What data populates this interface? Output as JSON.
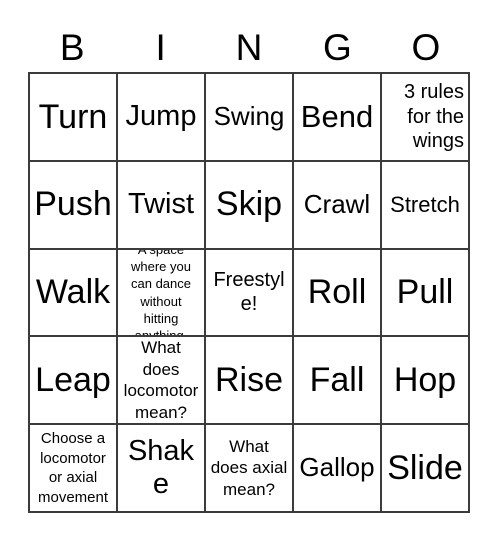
{
  "card": {
    "title_letters": [
      "B",
      "I",
      "N",
      "G",
      "O"
    ],
    "columns": 5,
    "rows": 5,
    "border_color": "#3b3b3b",
    "background_color": "#ffffff",
    "text_color": "#000000"
  },
  "cells": [
    {
      "text": "Turn",
      "size": "fs-xxl",
      "align": "align-center"
    },
    {
      "text": "Jump",
      "size": "fs-l",
      "align": "align-center"
    },
    {
      "text": "Swing",
      "size": "fs-m",
      "align": "align-center"
    },
    {
      "text": "Bend",
      "size": "fs-xl",
      "align": "align-center"
    },
    {
      "text": "3 rules for the wings",
      "size": "fs-xs",
      "align": "align-right"
    },
    {
      "text": "Push",
      "size": "fs-xxl",
      "align": "align-center"
    },
    {
      "text": "Twist",
      "size": "fs-l",
      "align": "align-center"
    },
    {
      "text": "Skip",
      "size": "fs-xxl",
      "align": "align-center"
    },
    {
      "text": "Crawl",
      "size": "fs-m",
      "align": "align-center"
    },
    {
      "text": "Stretch",
      "size": "fs-s",
      "align": "align-center"
    },
    {
      "text": "Walk",
      "size": "fs-xxl",
      "align": "align-center"
    },
    {
      "text": "A space where you can dance without hitting anything.",
      "size": "fs-4xs",
      "align": "align-center"
    },
    {
      "text": "Freestyle!",
      "size": "fs-xs",
      "align": "align-center"
    },
    {
      "text": "Roll",
      "size": "fs-xxl",
      "align": "align-center"
    },
    {
      "text": "Pull",
      "size": "fs-xxl",
      "align": "align-center"
    },
    {
      "text": "Leap",
      "size": "fs-xxl",
      "align": "align-center"
    },
    {
      "text": "What does locomotor mean?",
      "size": "fs-xxs",
      "align": "align-center"
    },
    {
      "text": "Rise",
      "size": "fs-xxl",
      "align": "align-center"
    },
    {
      "text": "Fall",
      "size": "fs-xxl",
      "align": "align-center"
    },
    {
      "text": "Hop",
      "size": "fs-xxl",
      "align": "align-center"
    },
    {
      "text": "Choose a locomotor or axial movement",
      "size": "fs-3xs",
      "align": "align-center"
    },
    {
      "text": "Shake",
      "size": "fs-l",
      "align": "align-center"
    },
    {
      "text": "What does axial mean?",
      "size": "fs-xxs",
      "align": "align-center"
    },
    {
      "text": "Gallop",
      "size": "fs-m",
      "align": "align-center"
    },
    {
      "text": "Slide",
      "size": "fs-xxl",
      "align": "align-center"
    }
  ]
}
